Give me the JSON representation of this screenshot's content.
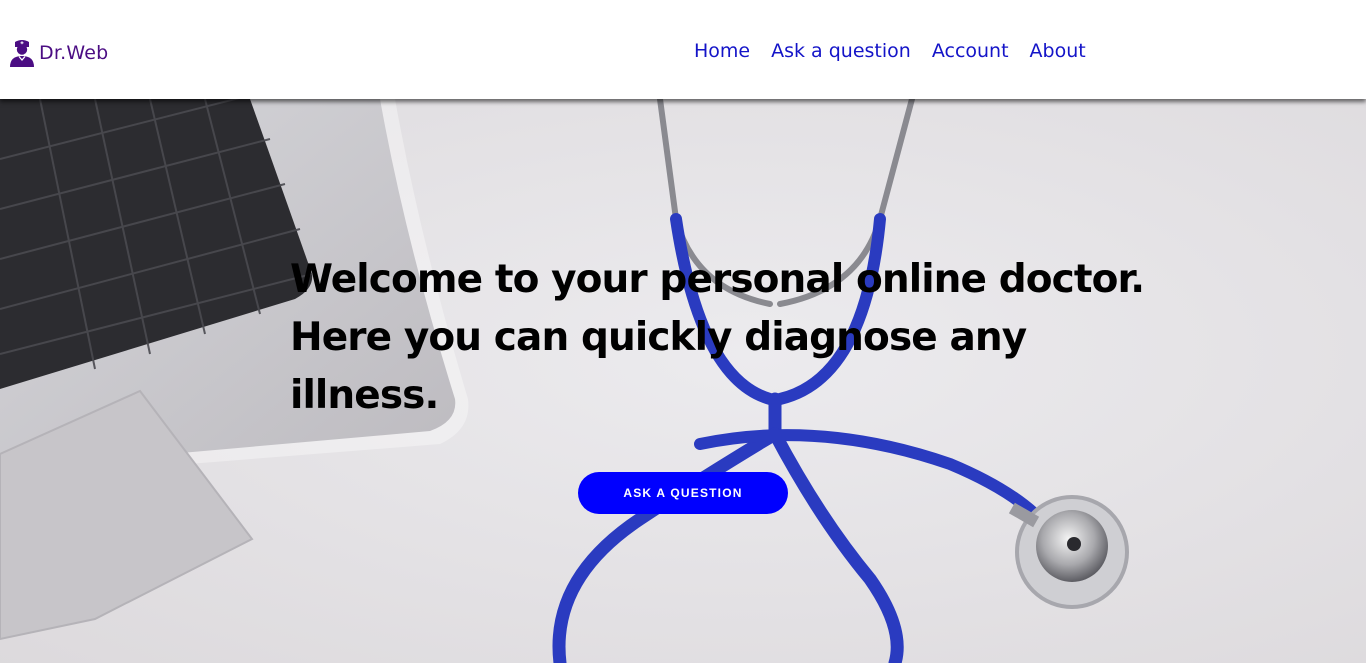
{
  "header": {
    "brand": {
      "icon": "doctor-user-icon",
      "label": "Dr.Web"
    },
    "nav": [
      {
        "label": "Home"
      },
      {
        "label": "Ask a question"
      },
      {
        "label": "Account"
      },
      {
        "label": "About"
      }
    ]
  },
  "hero": {
    "background": "laptop-and-stethoscope-photo",
    "heading_lines": [
      "Welcome to your personal online doctor.",
      "Here you can quickly diagnose any",
      "illness."
    ],
    "cta_label": "ASK A QUESTION"
  },
  "colors": {
    "brand": "#4b0d83",
    "nav_link": "#1414c8",
    "cta_background": "#0000ff",
    "cta_text": "#ffffff",
    "heading": "#000000",
    "stethoscope_tube": "#2a3bc0"
  }
}
